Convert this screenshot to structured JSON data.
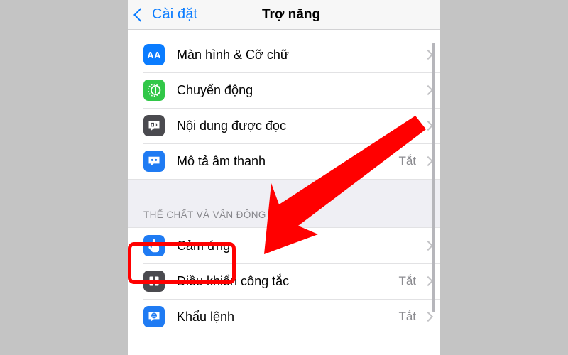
{
  "navbar": {
    "back_label": "Cài đặt",
    "title": "Trợ năng",
    "back_icon": "chevron-left-icon",
    "accent_color": "#0a7cff"
  },
  "groups": [
    {
      "id": "vision",
      "section_title": "",
      "rows": [
        {
          "label": "Màn hình & Cỡ chữ",
          "value": "",
          "icon": "display-text-size-icon",
          "icon_glyph": "AA",
          "icon_class": "ic-display"
        },
        {
          "label": "Chuyển động",
          "value": "",
          "icon": "motion-icon",
          "icon_glyph": "",
          "icon_class": "ic-motion"
        },
        {
          "label": "Nội dung được đọc",
          "value": "",
          "icon": "spoken-content-icon",
          "icon_glyph": "",
          "icon_class": "ic-speech"
        },
        {
          "label": "Mô tả âm thanh",
          "value": "Tắt",
          "icon": "audio-description-icon",
          "icon_glyph": "",
          "icon_class": "ic-audio"
        }
      ]
    },
    {
      "id": "physical-motor",
      "section_title": "THỂ CHẤT VÀ VẬN ĐỘNG",
      "rows": [
        {
          "label": "Cảm ứng",
          "value": "",
          "icon": "touch-hand-icon",
          "icon_glyph": "",
          "icon_class": "ic-touch"
        },
        {
          "label": "Điều khiển công tắc",
          "value": "Tắt",
          "icon": "switch-control-icon",
          "icon_glyph": "",
          "icon_class": "ic-switch"
        },
        {
          "label": "Khẩu lệnh",
          "value": "Tắt",
          "icon": "voice-control-icon",
          "icon_glyph": "",
          "icon_class": "ic-voice"
        }
      ]
    }
  ],
  "annotations": {
    "highlight_target": "Cảm ứng",
    "highlight_color": "#ff0000",
    "arrow_color": "#ff0000",
    "arrow_from": "top-right",
    "arrow_to": "Cảm ứng"
  },
  "colors": {
    "page_background": "#c4c4c4",
    "list_background": "#ffffff",
    "section_band": "#efeff4",
    "value_text": "#8b8b90",
    "separator": "#e2e2e4"
  }
}
